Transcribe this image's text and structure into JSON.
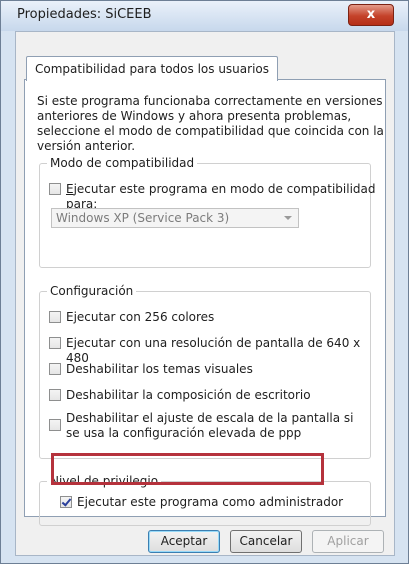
{
  "window": {
    "title": "Propiedades: SiCEEB",
    "close_glyph": "x"
  },
  "tab": {
    "label": "Compatibilidad para todos los usuarios"
  },
  "intro_text": "Si este programa funcionaba correctamente en versiones anteriores de Windows y ahora presenta problemas, seleccione el modo de compatibilidad que coincida con la versión anterior.",
  "compat_mode": {
    "legend": "Modo de compatibilidad",
    "checkbox_label_underlined": "E",
    "checkbox_label_rest": "jecutar este programa en modo de compatibilidad para:",
    "checkbox_checked": false,
    "select_value": "Windows XP (Service Pack 3)"
  },
  "config": {
    "legend": "Configuración",
    "options": [
      {
        "label": "Ejecutar con 256 colores",
        "checked": false
      },
      {
        "label": "Ejecutar con una resolución de pantalla de 640 x 480",
        "checked": false
      },
      {
        "label": "Deshabilitar los temas visuales",
        "checked": false
      },
      {
        "label": "Deshabilitar la composición de escritorio",
        "checked": false
      },
      {
        "label": "Deshabilitar el ajuste de escala de la pantalla si se usa la configuración elevada de ppp",
        "checked": false
      }
    ]
  },
  "privilege": {
    "legend": "Nivel de privilegio",
    "option_label": "Ejecutar este programa como administrador",
    "checked": true
  },
  "buttons": {
    "ok": "Aceptar",
    "cancel": "Cancelar",
    "apply": "Aplicar"
  },
  "colors": {
    "highlight": "#b5323c",
    "close": "#c4422a"
  }
}
